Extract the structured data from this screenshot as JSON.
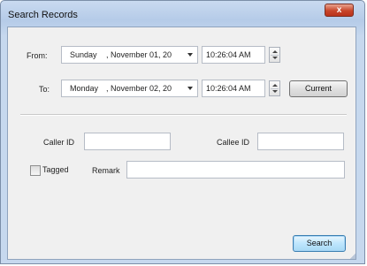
{
  "window": {
    "title": "Search Records",
    "close_glyph": "x"
  },
  "from": {
    "label": "From:",
    "day": "Sunday",
    "date_rest": ", November 01, 20",
    "time": "10:26:04 AM"
  },
  "to": {
    "label": "To:",
    "day": "Monday",
    "date_rest": ", November 02, 20",
    "time": "10:26:04 AM"
  },
  "buttons": {
    "current": "Current",
    "search": "Search"
  },
  "fields": {
    "caller_id_label": "Caller ID",
    "caller_id_value": "",
    "callee_id_label": "Callee ID",
    "callee_id_value": "",
    "tagged_label": "Tagged",
    "tagged_checked": false,
    "remark_label": "Remark",
    "remark_value": ""
  },
  "icons": {
    "dropdown": "chevron-down-icon",
    "spinner": "spinner-arrows-icon",
    "close": "close-icon"
  },
  "colors": {
    "title_bar": "#b5cbe8",
    "close_button": "#c8452a",
    "client_bg": "#f0f0f0",
    "focus_button": "#bee6fd"
  }
}
